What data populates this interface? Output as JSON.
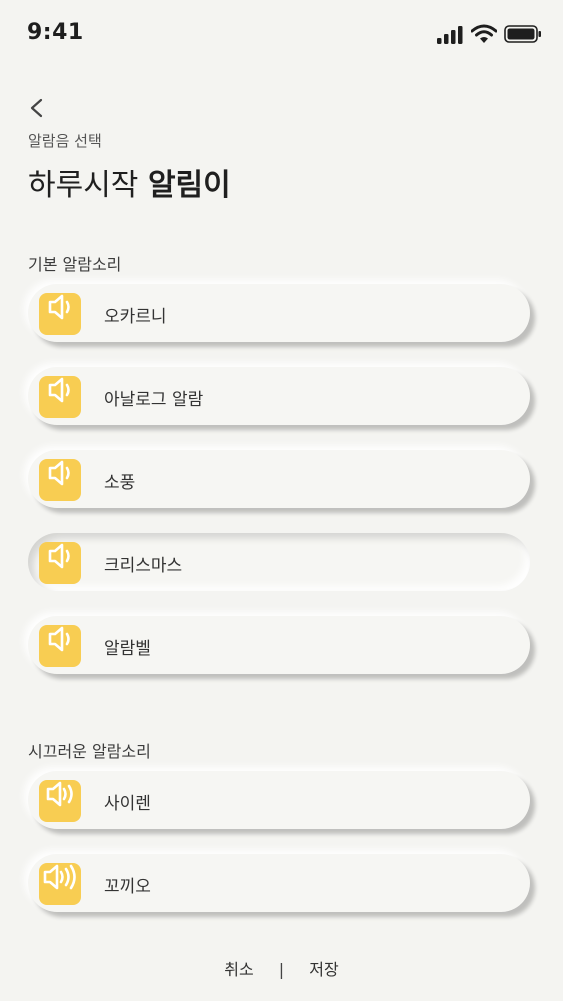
{
  "status_bar": {
    "time": "9:41"
  },
  "header": {
    "subtitle": "알람음 선택",
    "title_regular": "하루시작 ",
    "title_bold": "알림이"
  },
  "sections": [
    {
      "label": "기본 알람소리",
      "items": [
        {
          "label": "오카르니",
          "icon": "speaker-low-icon"
        },
        {
          "label": "아날로그 알람",
          "icon": "speaker-low-icon"
        },
        {
          "label": "소풍",
          "icon": "speaker-low-icon"
        },
        {
          "label": "크리스마스",
          "icon": "speaker-low-icon",
          "selected": true
        },
        {
          "label": "알람벨",
          "icon": "speaker-low-icon"
        }
      ]
    },
    {
      "label": "시끄러운 알람소리",
      "items": [
        {
          "label": "사이렌",
          "icon": "speaker-medium-icon"
        },
        {
          "label": "꼬끼오",
          "icon": "speaker-loud-icon"
        }
      ]
    }
  ],
  "footer": {
    "cancel": "취소",
    "separator": "|",
    "save": "저장"
  },
  "colors": {
    "accent": "#f8cd52",
    "background": "#f4f4f1"
  }
}
